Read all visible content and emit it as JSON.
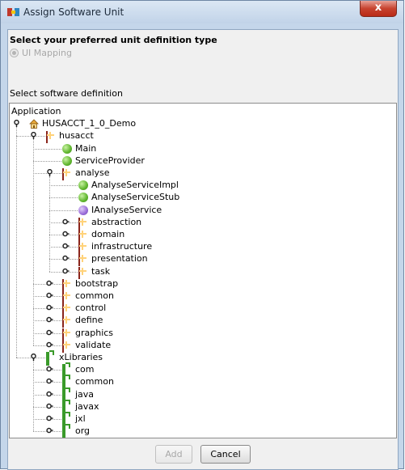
{
  "window": {
    "title": "Assign Software Unit",
    "close_label": "x"
  },
  "unit_type": {
    "heading": "Select your preferred unit definition type",
    "option_label": "UI Mapping",
    "option_selected": true,
    "option_enabled": false
  },
  "definition": {
    "heading": "Select software definition"
  },
  "tree": {
    "rows": [
      {
        "label": "Application",
        "icon": "none",
        "level": 0,
        "handle": "none"
      },
      {
        "label": "HUSACCT_1_0_Demo",
        "icon": "home-icon",
        "level": 1,
        "handle": "expanded"
      },
      {
        "label": "husacct",
        "icon": "package-icon",
        "level": 2,
        "handle": "expanded"
      },
      {
        "label": "Main",
        "icon": "class-icon",
        "level": 3,
        "handle": "none"
      },
      {
        "label": "ServiceProvider",
        "icon": "class-icon",
        "level": 3,
        "handle": "none"
      },
      {
        "label": "analyse",
        "icon": "package-icon",
        "level": 3,
        "handle": "expanded"
      },
      {
        "label": "AnalyseServiceImpl",
        "icon": "class-icon",
        "level": 4,
        "handle": "none"
      },
      {
        "label": "AnalyseServiceStub",
        "icon": "class-icon",
        "level": 4,
        "handle": "none"
      },
      {
        "label": "IAnalyseService",
        "icon": "interface-icon",
        "level": 4,
        "handle": "none"
      },
      {
        "label": "abstraction",
        "icon": "package-icon",
        "level": 4,
        "handle": "collapsed"
      },
      {
        "label": "domain",
        "icon": "package-icon",
        "level": 4,
        "handle": "collapsed"
      },
      {
        "label": "infrastructure",
        "icon": "package-icon",
        "level": 4,
        "handle": "collapsed"
      },
      {
        "label": "presentation",
        "icon": "package-icon",
        "level": 4,
        "handle": "collapsed"
      },
      {
        "label": "task",
        "icon": "package-icon",
        "level": 4,
        "handle": "collapsed"
      },
      {
        "label": "bootstrap",
        "icon": "package-icon",
        "level": 3,
        "handle": "collapsed"
      },
      {
        "label": "common",
        "icon": "package-icon",
        "level": 3,
        "handle": "collapsed"
      },
      {
        "label": "control",
        "icon": "package-icon",
        "level": 3,
        "handle": "collapsed"
      },
      {
        "label": "define",
        "icon": "package-icon",
        "level": 3,
        "handle": "collapsed"
      },
      {
        "label": "graphics",
        "icon": "package-icon",
        "level": 3,
        "handle": "collapsed"
      },
      {
        "label": "validate",
        "icon": "package-icon",
        "level": 3,
        "handle": "collapsed"
      },
      {
        "label": "xLibraries",
        "icon": "library-icon",
        "level": 2,
        "handle": "expanded"
      },
      {
        "label": "com",
        "icon": "library-icon",
        "level": 3,
        "handle": "collapsed"
      },
      {
        "label": "common",
        "icon": "library-icon",
        "level": 3,
        "handle": "collapsed"
      },
      {
        "label": "java",
        "icon": "library-icon",
        "level": 3,
        "handle": "collapsed"
      },
      {
        "label": "javax",
        "icon": "library-icon",
        "level": 3,
        "handle": "collapsed"
      },
      {
        "label": "jxl",
        "icon": "library-icon",
        "level": 3,
        "handle": "collapsed"
      },
      {
        "label": "org",
        "icon": "library-icon",
        "level": 3,
        "handle": "collapsed"
      }
    ]
  },
  "buttons": {
    "add_label": "Add",
    "add_enabled": false,
    "cancel_label": "Cancel"
  }
}
